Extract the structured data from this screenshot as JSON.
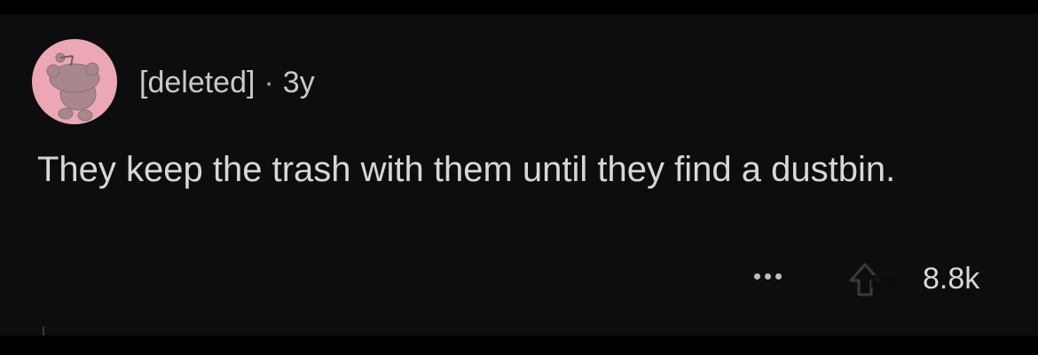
{
  "comment": {
    "author": "[deleted]",
    "separator": "·",
    "age": "3y",
    "body": "They keep the trash with them until they find a dustbin.",
    "score": "8.8k"
  },
  "icons": {
    "avatar": "snoo-avatar-icon",
    "more": "more-options-icon",
    "upvote": "upvote-arrow-icon"
  },
  "colors": {
    "background": "#0d0d0f",
    "avatar_bg": "#eba8b4",
    "text": "#d7d7d9"
  }
}
